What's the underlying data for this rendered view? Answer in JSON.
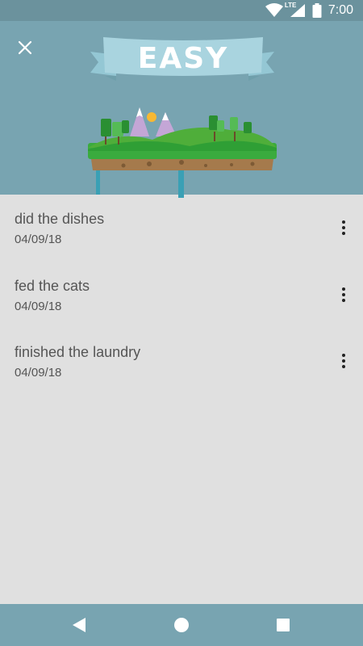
{
  "status_bar": {
    "time": "7:00",
    "network": "LTE",
    "icons": [
      "wifi-icon",
      "cell-signal-icon",
      "battery-icon"
    ]
  },
  "header": {
    "close_icon": "close-icon",
    "banner_text": "EASY"
  },
  "tasks": [
    {
      "title": "did the dishes",
      "date": "04/09/18"
    },
    {
      "title": "fed the cats",
      "date": "04/09/18"
    },
    {
      "title": "finished the laundry",
      "date": "04/09/18"
    }
  ],
  "nav": {
    "icons": [
      "back-icon",
      "home-icon",
      "recents-icon"
    ]
  },
  "colors": {
    "status_bar": "#6b929d",
    "header": "#78a4b1",
    "list_background": "#e0e0e0",
    "banner": "#a9d4df",
    "grass": "#3aab3e",
    "soil": "#a57a4c",
    "water": "#3aa0b5"
  }
}
